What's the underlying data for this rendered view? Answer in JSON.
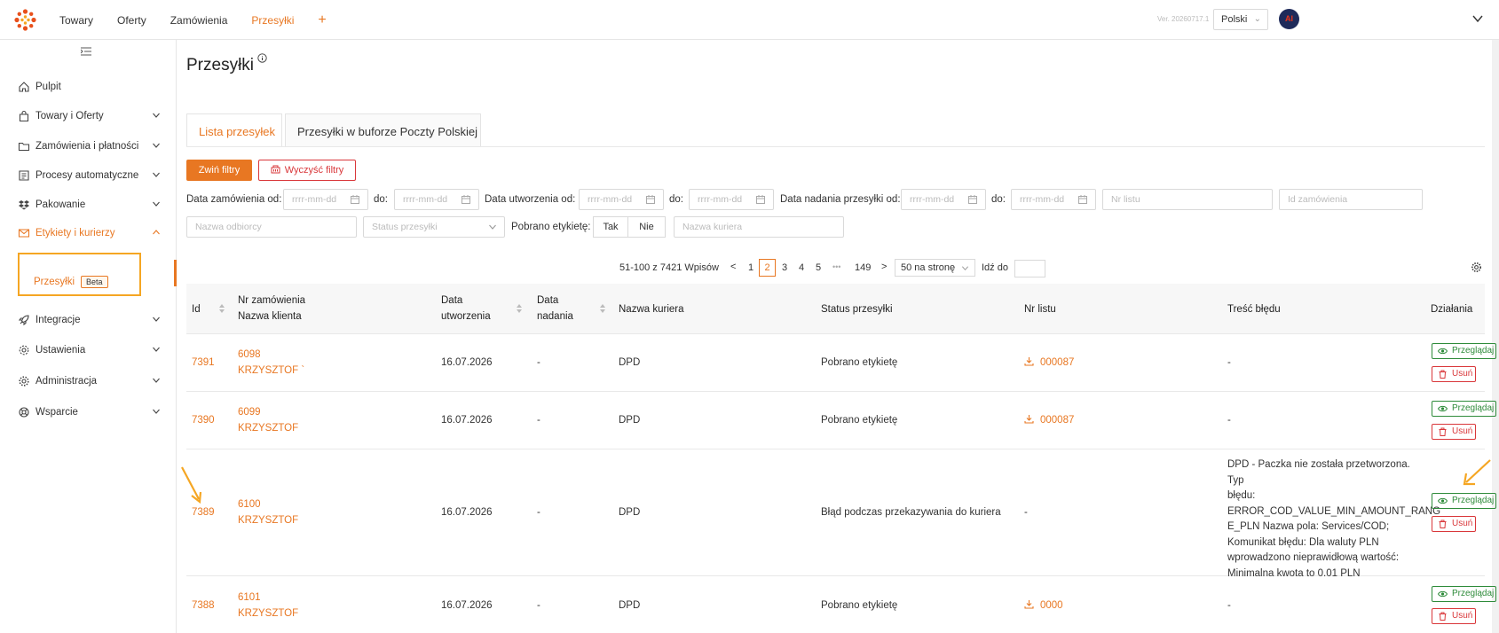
{
  "topbar": {
    "nav": [
      "Towary",
      "Oferty",
      "Zamówienia",
      "Przesyłki"
    ],
    "active_index": 3,
    "plus": "+",
    "version": "Ver. 20260717.1",
    "language": "Polski",
    "avatar_text": "AI"
  },
  "sidebar": {
    "items": [
      {
        "label": "Pulpit",
        "icon": "home-icon"
      },
      {
        "label": "Towary i Oferty",
        "icon": "bag-icon"
      },
      {
        "label": "Zamówienia i płatności",
        "icon": "folder-icon"
      },
      {
        "label": "Procesy automatyczne",
        "icon": "process-icon"
      },
      {
        "label": "Pakowanie",
        "icon": "dropbox-icon"
      },
      {
        "label": "Etykiety i kurierzy",
        "icon": "envelope-icon"
      },
      {
        "label": "Integracje",
        "icon": "rocket-icon"
      },
      {
        "label": "Ustawienia",
        "icon": "gear-icon"
      },
      {
        "label": "Administracja",
        "icon": "cog-icon"
      },
      {
        "label": "Wsparcie",
        "icon": "lifebuoy-icon"
      }
    ],
    "sub_item": "Przesyłki",
    "sub_badge": "Beta"
  },
  "page": {
    "title": "Przesyłki",
    "tabs": [
      "Lista przesyłek",
      "Przesyłki w buforze Poczty Polskiej"
    ]
  },
  "filters": {
    "toggle_button": "Zwiń filtry",
    "clear_button": "Wyczyść filtry",
    "order_date_from": "Data zamówienia od:",
    "to": "do:",
    "created_from": "Data utworzenia od:",
    "shipped_from": "Data nadania przesyłki od:",
    "date_placeholder": "rrrr-mm-dd",
    "nr_listu_placeholder": "Nr listu",
    "id_order_placeholder": "Id zamówienia",
    "recipient_placeholder": "Nazwa odbiorcy",
    "status_placeholder": "Status przesyłki",
    "label_downloaded": "Pobrano etykietę:",
    "yes": "Tak",
    "no": "Nie",
    "courier_placeholder": "Nazwa kuriera"
  },
  "pagination": {
    "range": "51-100 z 7421 Wpisów",
    "prev": "<",
    "pages": [
      "1",
      "2",
      "3",
      "4",
      "5",
      "•••",
      "149"
    ],
    "current": "2",
    "next": ">",
    "per_page": "50 na stronę",
    "goto": "Idź do"
  },
  "table": {
    "headers": {
      "id": "Id",
      "order": "Nr zamówienia",
      "client": "Nazwa klienta",
      "created": "Data utworzenia",
      "shipped": "Data nadania",
      "courier": "Nazwa kuriera",
      "status": "Status przesyłki",
      "nr_listu": "Nr listu",
      "error": "Treść błędu",
      "actions": "Działania"
    },
    "view_label": "Przeglądaj",
    "delete_label": "Usuń",
    "rows": [
      {
        "id": "7391",
        "order": "6098",
        "client": "KRZYSZTOF `",
        "created": "16.07.2026",
        "shipped": "-",
        "courier": "DPD",
        "status": "Pobrano etykietę",
        "nr_listu": "000087",
        "error": "-"
      },
      {
        "id": "7390",
        "order": "6099",
        "client": "KRZYSZTOF",
        "created": "16.07.2026",
        "shipped": "-",
        "courier": "DPD",
        "status": "Pobrano etykietę",
        "nr_listu": "000087",
        "error": "-"
      },
      {
        "id": "7389",
        "order": "6100",
        "client": "KRZYSZTOF",
        "created": "16.07.2026",
        "shipped": "-",
        "courier": "DPD",
        "status": "Błąd podczas przekazywania do kuriera",
        "nr_listu": "-",
        "error_lines": [
          "DPD - Paczka nie została przetworzona. Typ",
          "błędu:",
          "ERROR_COD_VALUE_MIN_AMOUNT_RANG",
          "E_PLN Nazwa pola: Services/COD;",
          "Komunikat błędu: Dla waluty PLN",
          "wprowadzono nieprawidłową wartość:",
          "Minimalna kwota to 0.01 PLN"
        ]
      },
      {
        "id": "7388",
        "order": "6101",
        "client": "KRZYSZTOF",
        "created": "16.07.2026",
        "shipped": "-",
        "courier": "DPD",
        "status": "Pobrano etykietę",
        "nr_listu": "0000",
        "error": "-"
      }
    ]
  },
  "colors": {
    "accent": "#e87722",
    "highlight": "#f5a623",
    "view": "#2e8b3a",
    "delete": "#d9373a"
  }
}
